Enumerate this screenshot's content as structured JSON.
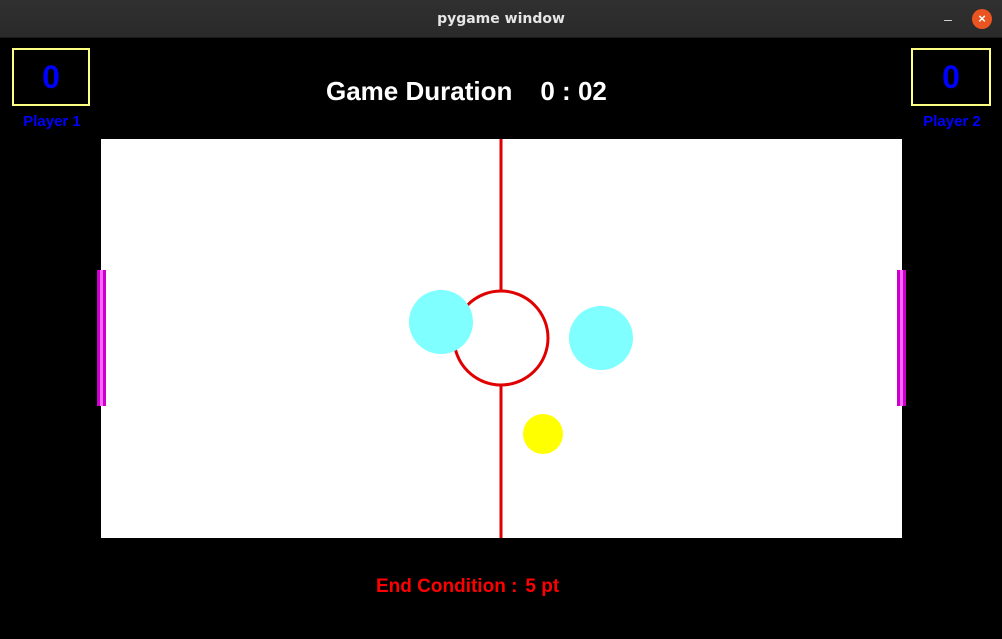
{
  "window": {
    "title": "pygame window",
    "minimize_glyph": "–",
    "close_glyph": "×"
  },
  "scoreboard": {
    "player1": {
      "score": "0",
      "label": "Player 1"
    },
    "player2": {
      "score": "0",
      "label": "Player 2"
    }
  },
  "timer": {
    "label": "Game Duration",
    "value": "0 : 02"
  },
  "end_condition": {
    "label": "End Condition :",
    "value": "5 pt"
  },
  "colors": {
    "background": "#000000",
    "rink": "#ffffff",
    "center_line": "#e00000",
    "mallet": "#7fffff",
    "puck": "#ffff00",
    "goal": "#e020e0",
    "score_text": "#0000ff",
    "score_border": "#ffff80",
    "end_condition_text": "#ff0000"
  }
}
